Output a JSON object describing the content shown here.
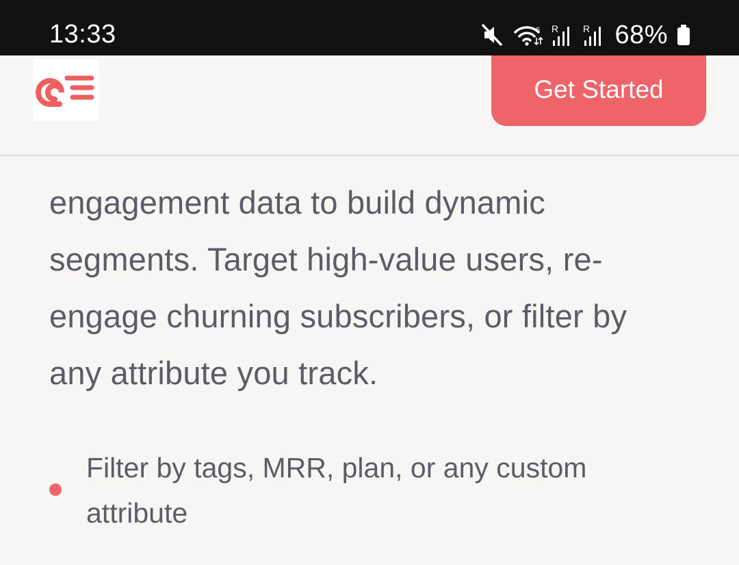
{
  "status_bar": {
    "time": "13:33",
    "battery_percent": "68%",
    "icons": [
      "mute-icon",
      "wifi-icon",
      "signal-r-icon",
      "signal-r-icon",
      "battery-icon"
    ],
    "background_color": "#111111"
  },
  "header": {
    "logo": "brand-logo-icon",
    "cta_label": "Get Started",
    "accent_color": "#ef6468"
  },
  "content": {
    "paragraph": "engagement data to build dynamic segments. Target high-value users, re-engage churning subscribers, or filter by any attribute you track.",
    "bullets": [
      {
        "text": "Filter by tags, MRR, plan, or any custom attribute"
      }
    ]
  }
}
